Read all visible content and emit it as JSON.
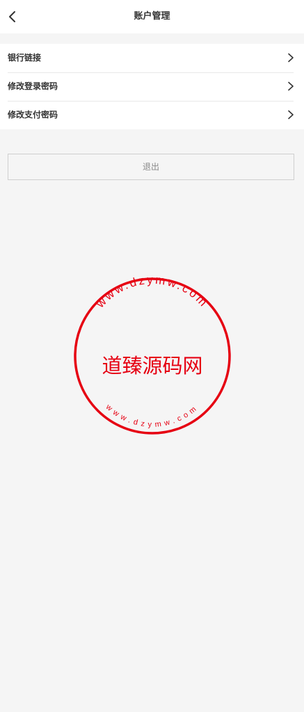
{
  "header": {
    "title": "账户管理",
    "back_icon": "chevron-left-icon"
  },
  "menu": {
    "items": [
      {
        "label": "银行链接"
      },
      {
        "label": "修改登录密码"
      },
      {
        "label": "修改支付密码"
      }
    ]
  },
  "logout": {
    "label": "退出"
  },
  "watermark": {
    "name": "道臻源码网",
    "url_top": "www.dzymw.com",
    "url_bottom": "www.dzymw.com",
    "color": "#e60012"
  }
}
